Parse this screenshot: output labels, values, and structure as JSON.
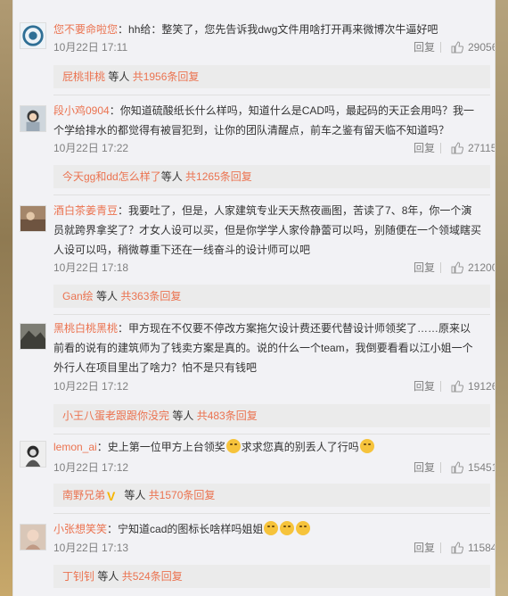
{
  "comments": [
    {
      "user": "您不要命啦您",
      "text": "：hh给：整笑了，您先告诉我dwg文件用啥打开再来微博次牛逼好吧",
      "time": "10月22日 17:11",
      "reply_label": "回复",
      "likes": "29056",
      "reply_user": "屁桃非桃",
      "reply_mid": " 等人 ",
      "reply_count": "共1956条回复"
    },
    {
      "user": "段小鸡0904",
      "text": "：你知道硫酸纸长什么样吗，知道什么是CAD吗，最起码的天正会用吗？我一个学给排水的都觉得有被冒犯到，让你的团队清醒点，前车之鉴有留天临不知道吗？",
      "time": "10月22日 17:22",
      "reply_label": "回复",
      "likes": "27115",
      "reply_user": "今天gg和dd怎么样了",
      "reply_mid": "等人 ",
      "reply_count": "共1265条回复"
    },
    {
      "user": "酒白茶姜青豆",
      "text": "：我要吐了，但是，人家建筑专业天天熬夜画图，苦读了7、8年，你一个演员就跨界拿奖了？才女人设可以买，但是你学学人家伶静蕾可以吗，别随便在一个领域瞎买人设可以吗，稍微尊重下还在一线奋斗的设计师可以吧",
      "time": "10月22日 17:18",
      "reply_label": "回复",
      "likes": "21200",
      "reply_user": "Gan绘",
      "reply_mid": " 等人 ",
      "reply_count": "共363条回复"
    },
    {
      "user": "黑桃白桃黑桃",
      "text": "：甲方现在不仅要不停改方案拖欠设计费还要代替设计师领奖了……原来以前看的说有的建筑师为了钱卖方案是真的。说的什么一个team，我倒要看看以江小姐一个外行人在项目里出了啥力？怕不是只有钱吧",
      "time": "10月22日 17:12",
      "reply_label": "回复",
      "likes": "19126",
      "reply_user": "小王八蛋老跟跟你没完",
      "reply_mid": " 等人 ",
      "reply_count": "共483条回复"
    },
    {
      "user": "lemon_ai",
      "text_a": "：史上第一位甲方上台领奖",
      "text_b": "求求您真的别丢人了行吗",
      "time": "10月22日 17:12",
      "reply_label": "回复",
      "likes": "15451",
      "reply_user": "南野兄弟",
      "reply_mid": " 等人 ",
      "reply_count": "共1570条回复"
    },
    {
      "user": "小张想笑笑",
      "text": "：宁知道cad的图标长啥样吗姐姐",
      "time": "10月22日 17:13",
      "reply_label": "回复",
      "likes": "11584",
      "reply_user": "丁钊钊",
      "reply_mid": " 等人 ",
      "reply_count": "共524条回复"
    }
  ],
  "icons": {
    "like": "thumbs-up-icon",
    "verified": "v-badge-icon"
  },
  "colors": {
    "username": "#eb7350",
    "meta": "#808080",
    "panel": "#f2f2f5",
    "reply_bar": "#ebebeb"
  }
}
